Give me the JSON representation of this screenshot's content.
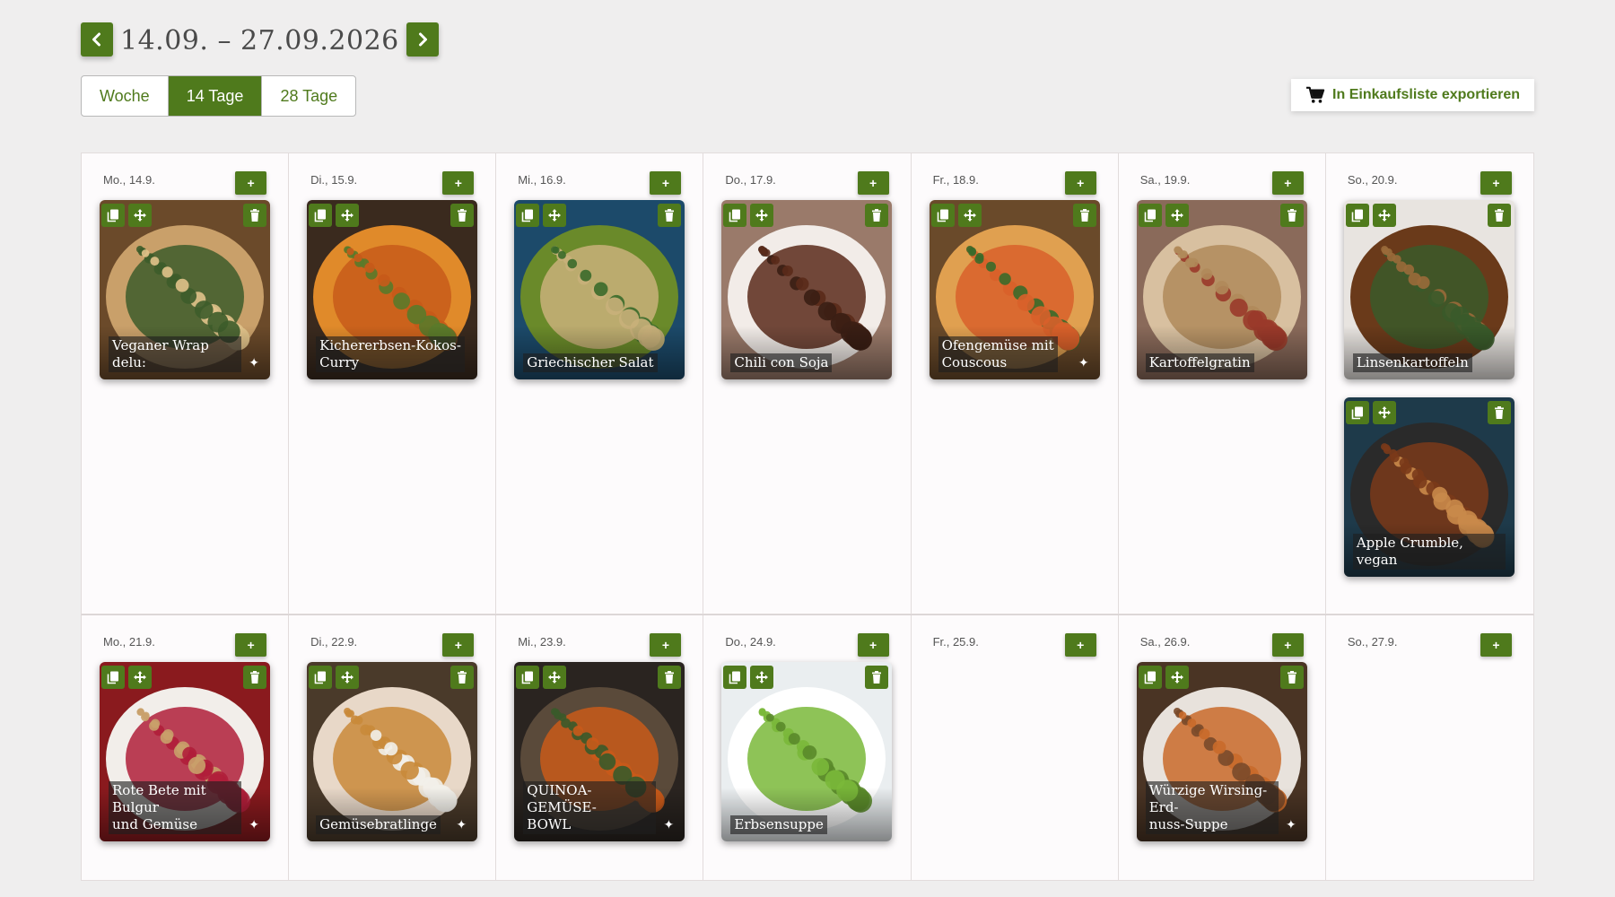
{
  "header": {
    "date_range": "14.09. – 27.09.2026",
    "ranges": [
      "Woche",
      "14 Tage",
      "28 Tage"
    ],
    "active_range": "14 Tage",
    "export_label": "In Einkaufsliste exportieren"
  },
  "colors": {
    "accent": "#4f7a1c"
  },
  "add_symbol": "+",
  "sparkle_symbol": "✦",
  "weeks": [
    {
      "days": [
        {
          "label": "Mo., 14.9.",
          "recipes": [
            {
              "title": "Veganer Wrap delu:",
              "sparkle": true,
              "palette": [
                "#6b4a2a",
                "#c9a06a",
                "#3d5c2a",
                "#e0c28a"
              ]
            }
          ]
        },
        {
          "label": "Di., 15.9.",
          "recipes": [
            {
              "title": "Kichererbsen-Kokos-\nCurry",
              "sparkle": false,
              "palette": [
                "#3a2a1e",
                "#e08a2a",
                "#c75a1a",
                "#5a7a2a"
              ]
            }
          ]
        },
        {
          "label": "Mi., 16.9.",
          "recipes": [
            {
              "title": "Griechischer Salat",
              "sparkle": false,
              "palette": [
                "#1c4a6a",
                "#6a8a2a",
                "#c9b07a",
                "#3a6a2a"
              ]
            }
          ]
        },
        {
          "label": "Do., 17.9.",
          "recipes": [
            {
              "title": "Chili con Soja",
              "sparkle": false,
              "palette": [
                "#9a7a6a",
                "#f2ece8",
                "#5a2a1a",
                "#3a1e14"
              ]
            }
          ]
        },
        {
          "label": "Fr., 18.9.",
          "recipes": [
            {
              "title": "Ofengemüse mit\nCouscous",
              "sparkle": true,
              "palette": [
                "#6a4a2a",
                "#e0a050",
                "#d8602a",
                "#3a6a2a"
              ]
            }
          ]
        },
        {
          "label": "Sa., 19.9.",
          "recipes": [
            {
              "title": "Kartoffelgratin",
              "sparkle": false,
              "palette": [
                "#8a6a5a",
                "#d8c0a0",
                "#b08a5a",
                "#9a3a2a"
              ]
            }
          ]
        },
        {
          "label": "So., 20.9.",
          "recipes": [
            {
              "title": "Linsenkartoffeln",
              "sparkle": false,
              "palette": [
                "#e8e4e0",
                "#6a3a1a",
                "#3a5a2a",
                "#9a6a3a"
              ]
            },
            {
              "title": "Apple Crumble, vegan",
              "sparkle": false,
              "palette": [
                "#1e3a4a",
                "#2a2a2a",
                "#7a3a1a",
                "#c98a4a"
              ]
            }
          ]
        }
      ]
    },
    {
      "days": [
        {
          "label": "Mo., 21.9.",
          "recipes": [
            {
              "title": "Rote Bete mit Bulgur\nund Gemüse",
              "sparkle": true,
              "palette": [
                "#8a1a1e",
                "#f2eeea",
                "#b01e3a",
                "#c9a06a"
              ]
            }
          ]
        },
        {
          "label": "Di., 22.9.",
          "recipes": [
            {
              "title": "Gemüsebratlinge",
              "sparkle": true,
              "palette": [
                "#4a3a2a",
                "#e8d8c8",
                "#c98a3a",
                "#f2f0ea"
              ]
            }
          ]
        },
        {
          "label": "Mi., 23.9.",
          "recipes": [
            {
              "title": "QUINOA-GEMÜSE-\nBOWL",
              "sparkle": true,
              "palette": [
                "#2a2420",
                "#5a4a3a",
                "#c95a1a",
                "#3a5a2a"
              ]
            }
          ]
        },
        {
          "label": "Do., 24.9.",
          "recipes": [
            {
              "title": "Erbsensuppe",
              "sparkle": false,
              "palette": [
                "#eaeef0",
                "#ffffff",
                "#7ab83a",
                "#5a8a2a"
              ]
            }
          ]
        },
        {
          "label": "Fr., 25.9.",
          "recipes": []
        },
        {
          "label": "Sa., 26.9.",
          "recipes": [
            {
              "title": "Würzige Wirsing-Erd-\nnuss-Suppe",
              "sparkle": true,
              "palette": [
                "#4a3424",
                "#e8e2dc",
                "#c96a2a",
                "#7a4a2a"
              ]
            }
          ]
        },
        {
          "label": "So., 27.9.",
          "recipes": []
        }
      ]
    }
  ]
}
